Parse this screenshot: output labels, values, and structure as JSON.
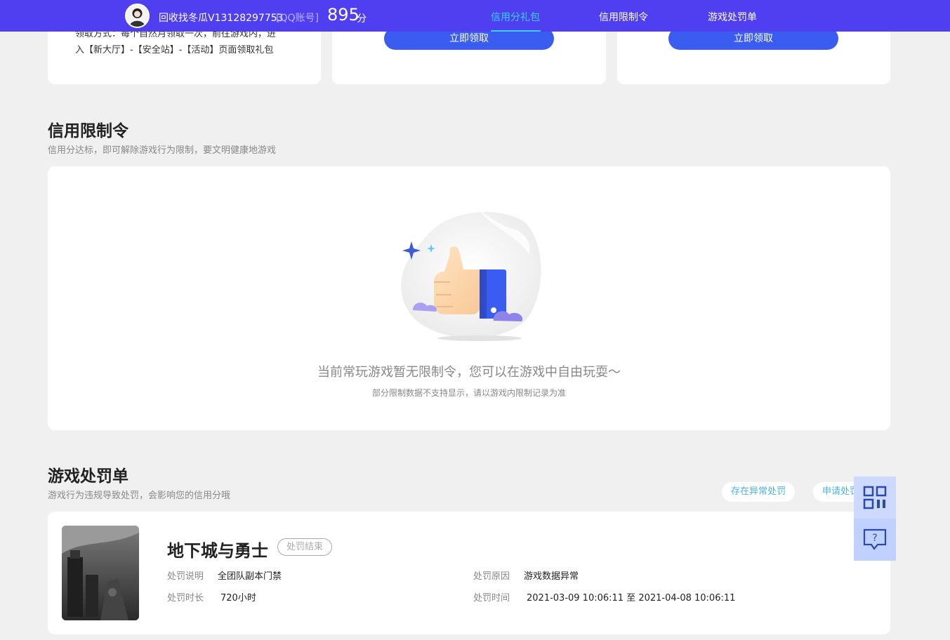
{
  "header": {
    "username": "回收找冬瓜V13128297753",
    "account_tag": "[QQ账号]",
    "score": "895",
    "score_unit": "分",
    "nav_tabs": [
      {
        "label": "信用分礼包",
        "active": true
      },
      {
        "label": "信用限制令",
        "active": false
      },
      {
        "label": "游戏处罚单",
        "active": false
      }
    ]
  },
  "gift_cards": {
    "card1_lines": [
      "领取方式：每个自然月领取一次，前往游戏内，进",
      "入【新大厅】-【安全站】-【活动】页面领取礼包"
    ],
    "claim_label": "立即领取"
  },
  "restriction": {
    "title": "信用限制令",
    "subtitle": "信用分达标，即可解除游戏行为限制，要文明健康地游戏",
    "empty_main": "当前常玩游戏暂无限制令，您可以在游戏中自由玩耍～",
    "empty_sub": "部分限制数据不支持显示，请以游戏内限制记录为准"
  },
  "penalty": {
    "title": "游戏处罚单",
    "subtitle": "游戏行为违规导致处罚，会影响您的信用分哦",
    "abnormal_label": "存在异常处罚",
    "appeal_label": "申请处罚",
    "item": {
      "game": "地下城与勇士",
      "status": "处罚结束",
      "desc_label": "处罚说明",
      "desc_value": "全团队副本门禁",
      "reason_label": "处罚原因",
      "reason_value": "游戏数据异常",
      "duration_label": "处罚时长",
      "duration_value": "720小时",
      "time_label": "处罚时间",
      "time_value": "2021-03-09 10:06:11 至 2021-04-08 10:06:11"
    }
  },
  "sidebar_icons": [
    "qr-code-icon",
    "help-chat-icon"
  ],
  "colors": {
    "topbar": "#4f3ff0",
    "active_tab": "#34d4ff",
    "button": "#3a5cf0",
    "pill_text": "#4ab1e8"
  }
}
